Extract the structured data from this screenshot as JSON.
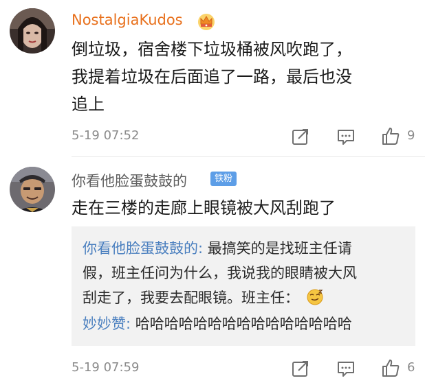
{
  "comments": [
    {
      "username": "NostalgiaKudos",
      "text_lines": [
        "倒垃圾，宿舍楼下垃圾桶被风吹跑了，",
        "我提着垃圾在后面追了一路，最后也没",
        "追上"
      ],
      "time": "5-19 07:52",
      "likes": "9",
      "badge_icon": "crown-badge-icon"
    },
    {
      "username": "你看他脸蛋鼓鼓的",
      "badge_label": "铁粉",
      "text": "走在三楼的走廊上眼镜被大风刮跑了",
      "replies": [
        {
          "user": "你看他脸蛋鼓鼓的:",
          "text_lines": [
            " 最搞笑的是找班主任请",
            "假，班主任问为什么，我说我的眼睛被大风",
            "刮走了，我要去配眼镜。班主任："
          ]
        },
        {
          "user": "妙妙赞:",
          "text": " 哈哈哈哈哈哈哈哈哈哈哈哈哈哈哈"
        }
      ],
      "time": "5-19 07:59",
      "likes": "6"
    }
  ]
}
